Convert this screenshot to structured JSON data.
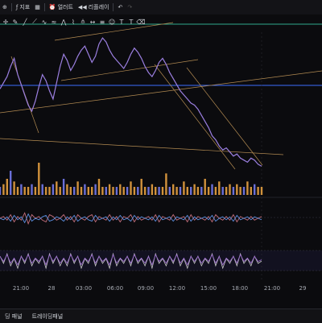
{
  "toolbar": {
    "indicators_label": "지표",
    "alert_label": "얼러트",
    "replay_label": "리플레이"
  },
  "time_axis": {
    "ticks": [
      "21:00",
      "28",
      "03:00",
      "06:00",
      "09:00",
      "12:00",
      "15:00",
      "18:00",
      "21:00",
      "29"
    ]
  },
  "bottom_bar": {
    "tab_left": "딩 패널",
    "tab_right": "트레이딩패널"
  },
  "colors": {
    "background": "#0b0b0e",
    "price_line": "#9b7fe0",
    "horizontal_level": "#3d6cff",
    "trendline": "#b38b52",
    "volume": "#d1923c",
    "osc_a": "#c26d7a",
    "osc_b": "#5a8fe0",
    "osc_c": "#c9c9c9"
  },
  "icons": [
    "add-icon",
    "indicators-icon",
    "grid-layout-icon",
    "alert-icon",
    "replay-icon",
    "undo-icon",
    "crosshair-icon",
    "brush-icon",
    "trend-line-icon",
    "text-icon",
    "measure-icon",
    "fib-icon"
  ],
  "chart_data": {
    "type": "line",
    "price_series": [
      41,
      44,
      47,
      52,
      56,
      48,
      43,
      38,
      33,
      30,
      35,
      42,
      48,
      45,
      40,
      36,
      44,
      52,
      58,
      55,
      50,
      53,
      57,
      60,
      62,
      58,
      54,
      57,
      63,
      66,
      64,
      60,
      57,
      55,
      53,
      51,
      54,
      58,
      61,
      59,
      56,
      52,
      49,
      47,
      50,
      54,
      56,
      53,
      49,
      46,
      43,
      40,
      38,
      36,
      34,
      33,
      31,
      28,
      25,
      22,
      18,
      16,
      13,
      11,
      12,
      10,
      8,
      9,
      7,
      6,
      5,
      7,
      6,
      4,
      3
    ],
    "volume_series": [
      3,
      4,
      6,
      9,
      5,
      3,
      4,
      3,
      3,
      4,
      3,
      12,
      4,
      3,
      3,
      4,
      5,
      3,
      6,
      4,
      3,
      3,
      5,
      3,
      4,
      3,
      3,
      4,
      6,
      3,
      3,
      4,
      3,
      3,
      4,
      3,
      3,
      5,
      3,
      3,
      6,
      3,
      3,
      4,
      3,
      3,
      3,
      8,
      3,
      4,
      3,
      3,
      5,
      3,
      3,
      4,
      3,
      3,
      6,
      3,
      4,
      3,
      5,
      3,
      3,
      4,
      3,
      4,
      3,
      3,
      5,
      3,
      4,
      3,
      3
    ],
    "osc1_series": [
      0,
      1,
      -1,
      2,
      -2,
      1,
      -1,
      3,
      -3,
      2,
      0,
      1,
      -1,
      -2,
      2,
      1,
      -1,
      0,
      2,
      -1,
      1,
      -2,
      2,
      0,
      -1,
      1,
      2,
      -2,
      1,
      0,
      -1,
      2,
      -1,
      1,
      -2,
      1,
      0,
      2,
      -2,
      1,
      -1,
      0,
      1,
      -1,
      2,
      -2,
      1,
      0,
      -1,
      2,
      -1,
      0,
      1,
      -2,
      2,
      -1,
      1,
      0,
      -1,
      1,
      -2,
      2,
      0,
      -1,
      1,
      -1,
      2,
      -2,
      1,
      0,
      -1,
      1,
      -1,
      0,
      1
    ],
    "osc2_series": [
      2,
      -1,
      3,
      -2,
      1,
      -3,
      2,
      -1,
      3,
      -2,
      1,
      -1,
      2,
      -3,
      3,
      -1,
      2,
      -2,
      1,
      -2,
      3,
      -1,
      2,
      -3,
      1,
      -1,
      3,
      -2,
      2,
      -1,
      1,
      -3,
      3,
      -2,
      1,
      -1,
      2,
      -2,
      3,
      -1,
      1,
      -2,
      2,
      -3,
      3,
      -1,
      1,
      -2,
      2,
      -1,
      3,
      -2,
      1,
      -3,
      2,
      -1,
      2,
      -2,
      1,
      -1,
      3,
      -2,
      2,
      -3,
      1,
      -1,
      2,
      -2,
      3,
      -1,
      1,
      -2,
      2,
      -1,
      0
    ]
  }
}
